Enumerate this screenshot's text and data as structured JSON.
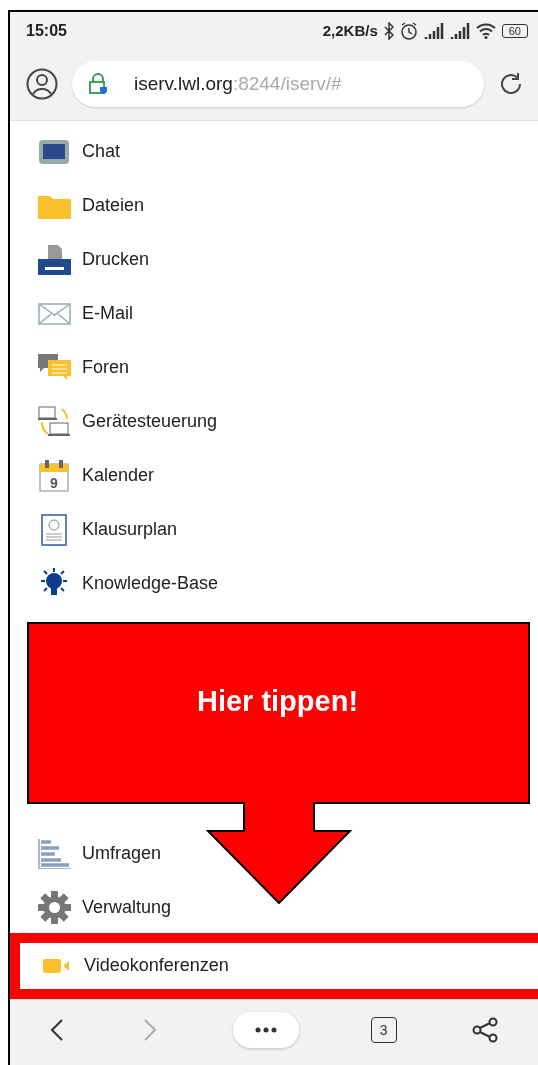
{
  "status_bar": {
    "time": "15:05",
    "speed": "2,2KB/s",
    "battery": "60"
  },
  "address_bar": {
    "host": "iserv.lwl.org",
    "path": ":8244/iserv/#"
  },
  "menu_items": [
    {
      "kind": "chat",
      "label": "Chat",
      "highlighted": false
    },
    {
      "kind": "files",
      "label": "Dateien",
      "highlighted": false
    },
    {
      "kind": "print",
      "label": "Drucken",
      "highlighted": false
    },
    {
      "kind": "mail",
      "label": "E-Mail",
      "highlighted": false
    },
    {
      "kind": "forum",
      "label": "Foren",
      "highlighted": false
    },
    {
      "kind": "devices",
      "label": "Gerätesteuerung",
      "highlighted": false
    },
    {
      "kind": "calendar",
      "label": "Kalender",
      "icon_text": "9",
      "highlighted": false
    },
    {
      "kind": "exam",
      "label": "Klausurplan",
      "highlighted": false
    },
    {
      "kind": "knowledge",
      "label": "Knowledge-Base",
      "highlighted": false
    },
    {
      "kind": "covered"
    },
    {
      "kind": "poll",
      "label": "Umfragen",
      "highlighted": false
    },
    {
      "kind": "admin",
      "label": "Verwaltung",
      "highlighted": false
    },
    {
      "kind": "video",
      "label": "Videokonferenzen",
      "highlighted": true
    }
  ],
  "callout": {
    "text": "Hier tippen!"
  },
  "bottom_bar": {
    "tabs_count": "3"
  }
}
